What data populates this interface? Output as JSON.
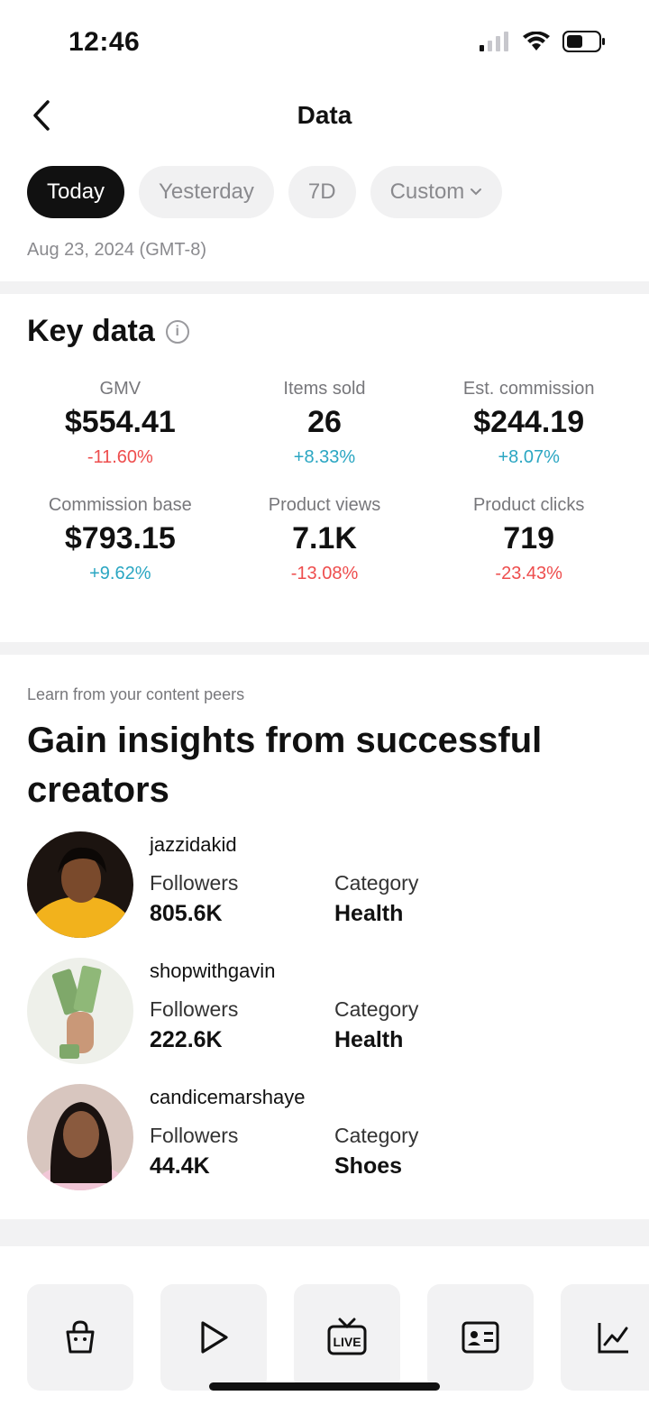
{
  "status": {
    "time": "12:46"
  },
  "nav": {
    "title": "Data"
  },
  "tabs": [
    {
      "label": "Today",
      "active": true
    },
    {
      "label": "Yesterday",
      "active": false
    },
    {
      "label": "7D",
      "active": false
    },
    {
      "label": "Custom",
      "active": false
    }
  ],
  "date_label": "Aug 23, 2024 (GMT-8)",
  "key_data": {
    "title": "Key data",
    "metrics": [
      {
        "label": "GMV",
        "value": "$554.41",
        "change": "-11.60%",
        "trend": "neg"
      },
      {
        "label": "Items sold",
        "value": "26",
        "change": "+8.33%",
        "trend": "pos"
      },
      {
        "label": "Est. commission",
        "value": "$244.19",
        "change": "+8.07%",
        "trend": "pos"
      },
      {
        "label": "Commission base",
        "value": "$793.15",
        "change": "+9.62%",
        "trend": "pos"
      },
      {
        "label": "Product views",
        "value": "7.1K",
        "change": "-13.08%",
        "trend": "neg"
      },
      {
        "label": "Product clicks",
        "value": "719",
        "change": "-23.43%",
        "trend": "neg"
      }
    ]
  },
  "peers": {
    "subtitle": "Learn from your content peers",
    "title": "Gain insights from successful creators",
    "followers_label": "Followers",
    "category_label": "Category",
    "creators": [
      {
        "name": "jazzidakid",
        "followers": "805.6K",
        "category": "Health"
      },
      {
        "name": "shopwithgavin",
        "followers": "222.6K",
        "category": "Health"
      },
      {
        "name": "candicemarshaye",
        "followers": "44.4K",
        "category": "Shoes"
      }
    ]
  },
  "bottom_nav": {
    "items": [
      {
        "icon": "shopping-bag-icon"
      },
      {
        "icon": "play-icon"
      },
      {
        "icon": "live-icon",
        "label": "LIVE"
      },
      {
        "icon": "profile-card-icon"
      },
      {
        "icon": "line-chart-icon"
      }
    ]
  },
  "colors": {
    "negative": "#ee4d4d",
    "positive": "#2aa6c2",
    "active_tab": "#111111"
  }
}
